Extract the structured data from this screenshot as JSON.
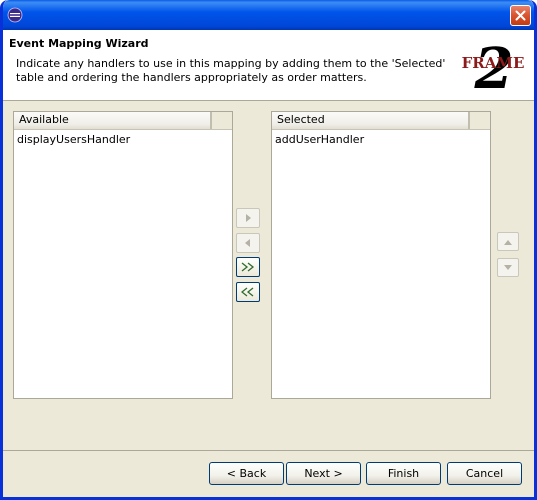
{
  "header": {
    "title": "Event Mapping Wizard",
    "description": "Indicate any handlers to use in this mapping by adding them to the 'Selected' table and ordering the handlers appropriately as order matters.",
    "logo_text": "FRAME",
    "logo_number": "2"
  },
  "available": {
    "column_header": "Available",
    "items": [
      "displayUsersHandler"
    ]
  },
  "selected": {
    "column_header": "Selected",
    "items": [
      "addUserHandler"
    ]
  },
  "footer": {
    "back_label": "< Back",
    "next_label": "Next >",
    "finish_label": "Finish",
    "cancel_label": "Cancel"
  },
  "colors": {
    "titlebar": "#0055ea",
    "close_button": "#d9532c",
    "logo_red": "#8b1a1a",
    "arrow_green": "#2e6b2e"
  }
}
